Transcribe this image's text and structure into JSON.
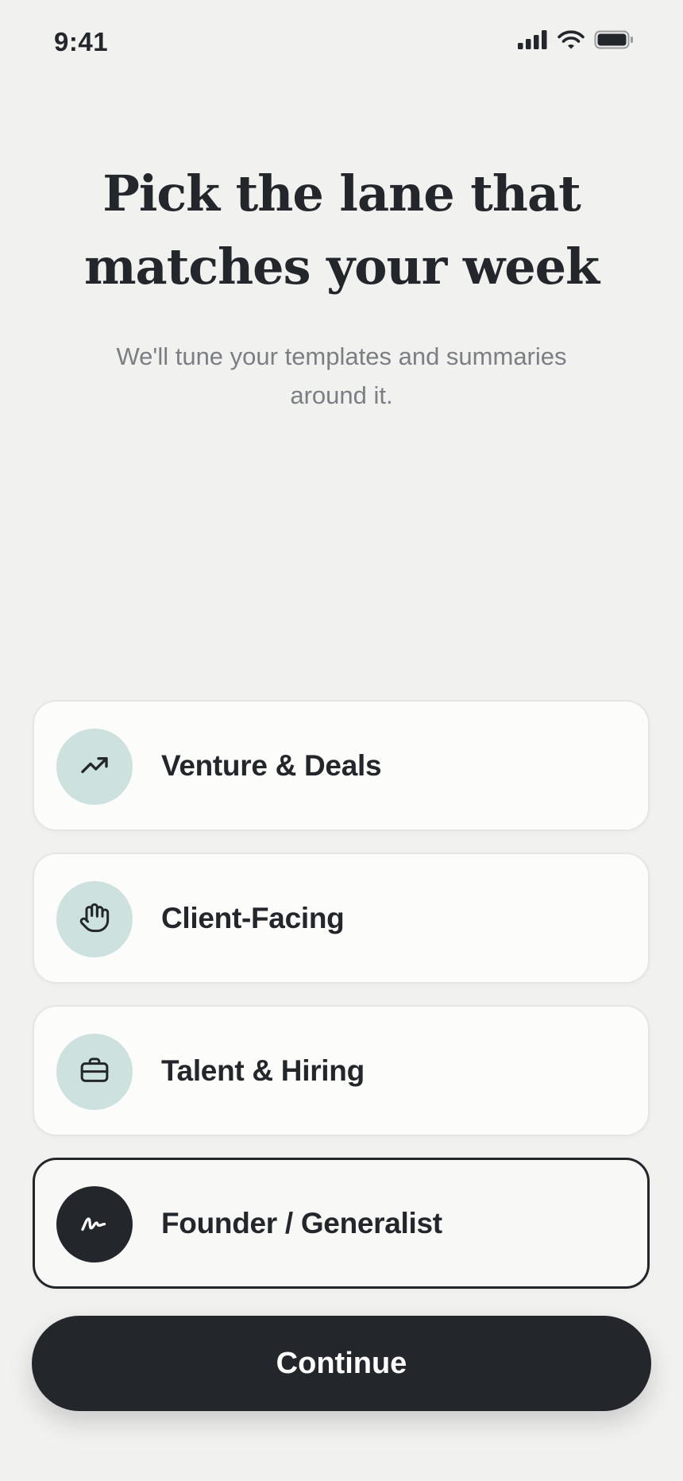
{
  "status_bar": {
    "time": "9:41",
    "icons": [
      "cellular-signal-icon",
      "wifi-icon",
      "battery-icon"
    ]
  },
  "header": {
    "title": "Pick the lane that matches your week",
    "subtitle": "We'll tune your templates and summaries around it."
  },
  "options": [
    {
      "label": "Venture & Deals",
      "icon": "trending-up-icon",
      "selected": false
    },
    {
      "label": "Client-Facing",
      "icon": "hand-icon",
      "selected": false
    },
    {
      "label": "Talent & Hiring",
      "icon": "briefcase-icon",
      "selected": false
    },
    {
      "label": "Founder / Generalist",
      "icon": "signature-icon",
      "selected": true
    }
  ],
  "footer": {
    "continue_label": "Continue"
  },
  "colors": {
    "background": "#f1f1ef",
    "ink": "#23272b",
    "muted_text": "#7b7f84",
    "icon_circle": "#cde2df",
    "card": "#fcfcfb",
    "card_border": "#e6e6e3"
  }
}
